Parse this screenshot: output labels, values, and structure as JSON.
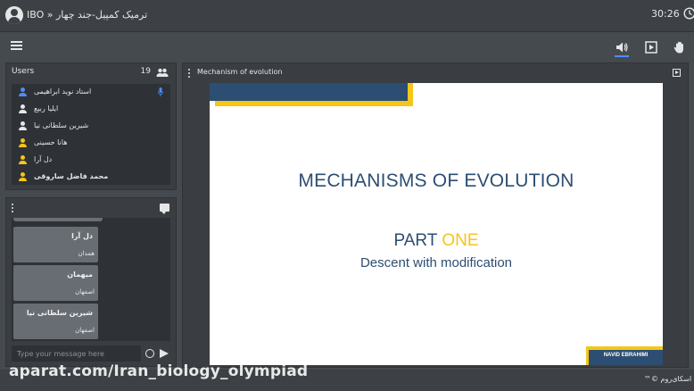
{
  "header": {
    "title": "IBO » ترمیک کمپیل-جند چهار",
    "time": "30:26"
  },
  "users": {
    "title": "Users",
    "count": "19",
    "items": [
      {
        "name": "استاد نوید ابراهیمی",
        "icon_color": "#4f8df5",
        "mic": true
      },
      {
        "name": "ایلیا ربیع",
        "icon_color": "#e6e6e6",
        "mic": false
      },
      {
        "name": "شیرین سلطانی نیا",
        "icon_color": "#e6e6e6",
        "mic": false
      },
      {
        "name": "هانا حسینی",
        "icon_color": "#f5c518",
        "mic": false
      },
      {
        "name": "دل آرا",
        "icon_color": "#f5c518",
        "mic": false
      },
      {
        "name": "محمد فاضل ساروقی",
        "icon_color": "#f5c518",
        "mic": false
      }
    ]
  },
  "chat": {
    "messages": [
      {
        "name": "دل آرا",
        "city": "همدان"
      },
      {
        "name": "میهمان",
        "city": "اصفهان"
      },
      {
        "name": "شیرین سلطانی نیا",
        "city": "اصفهان"
      }
    ],
    "placeholder": "Type your message here"
  },
  "presentation": {
    "title": "Mechanism of evolution",
    "slide": {
      "title": "MECHANISMS OF EVOLUTION",
      "part_a": "PART ",
      "part_b": "ONE",
      "subtitle": "Descent with modification",
      "author": "NAVID EBRAHIMI"
    }
  },
  "footer": {
    "brand": "اسکای‌روم ©™",
    "watermark": "aparat.com/Iran_biology_olympiad"
  },
  "colors": {
    "accent": "#4f8df5",
    "slide_blue": "#2c4e72",
    "slide_yellow": "#f5c518"
  }
}
